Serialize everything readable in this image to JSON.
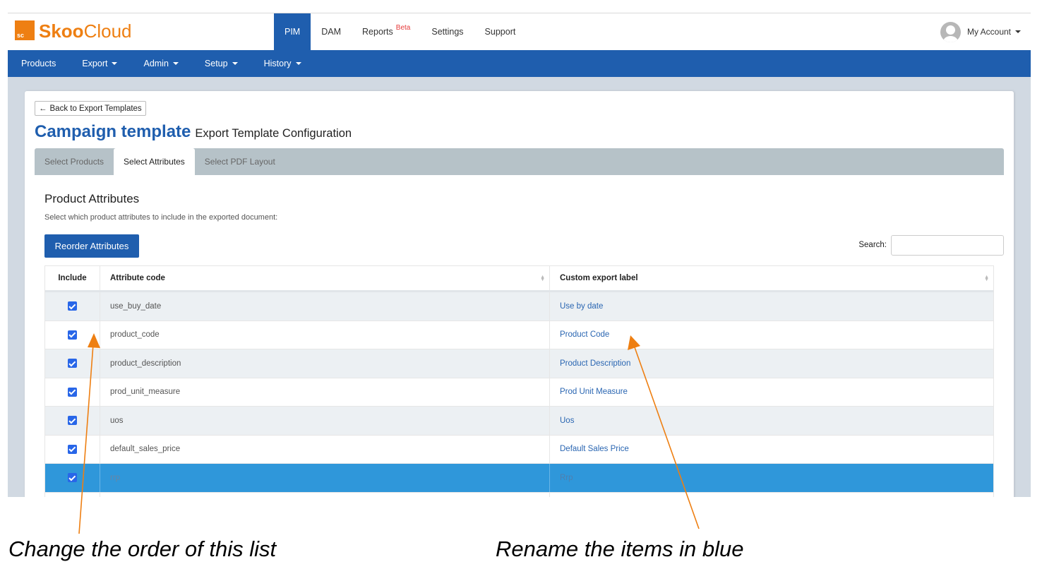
{
  "brand": {
    "logo_mark": "sc",
    "name_bold": "Skoo",
    "name_regular": "Cloud",
    "color": "#ee7f12"
  },
  "top_nav": {
    "items": [
      {
        "label": "PIM",
        "active": true
      },
      {
        "label": "DAM"
      },
      {
        "label": "Reports",
        "badge": "Beta"
      },
      {
        "label": "Settings"
      },
      {
        "label": "Support"
      }
    ],
    "account_label": "My Account"
  },
  "sub_nav": {
    "items": [
      {
        "label": "Products",
        "dropdown": false
      },
      {
        "label": "Export",
        "dropdown": true
      },
      {
        "label": "Admin",
        "dropdown": true
      },
      {
        "label": "Setup",
        "dropdown": true
      },
      {
        "label": "History",
        "dropdown": true
      }
    ]
  },
  "page": {
    "back_label": "Back to Export Templates",
    "title": "Campaign template",
    "subtitle": "Export Template Configuration",
    "tabs": [
      {
        "label": "Select Products"
      },
      {
        "label": "Select Attributes",
        "active": true
      },
      {
        "label": "Select PDF Layout"
      }
    ],
    "section_title": "Product Attributes",
    "section_desc": "Select which product attributes to include in the exported document:",
    "reorder_label": "Reorder Attributes",
    "search_label": "Search:",
    "search_value": ""
  },
  "table": {
    "headers": {
      "include": "Include",
      "code": "Attribute code",
      "label": "Custom export label"
    },
    "rows": [
      {
        "include": true,
        "code": "use_buy_date",
        "label": "Use by date"
      },
      {
        "include": true,
        "code": "product_code",
        "label": "Product Code"
      },
      {
        "include": true,
        "code": "product_description",
        "label": "Product Description"
      },
      {
        "include": true,
        "code": "prod_unit_measure",
        "label": "Prod Unit Measure"
      },
      {
        "include": true,
        "code": "uos",
        "label": "Uos"
      },
      {
        "include": true,
        "code": "default_sales_price",
        "label": "Default Sales Price"
      },
      {
        "include": true,
        "code": "rrp",
        "label": "Rrp",
        "selected": true
      }
    ]
  },
  "annotations": {
    "left": "Change the order of this list",
    "right": "Rename the items in blue",
    "arrow_color": "#ee7f12"
  },
  "colors": {
    "primary": "#1f5eae",
    "selected_row": "#2f97da",
    "beta": "#e63b3b"
  }
}
